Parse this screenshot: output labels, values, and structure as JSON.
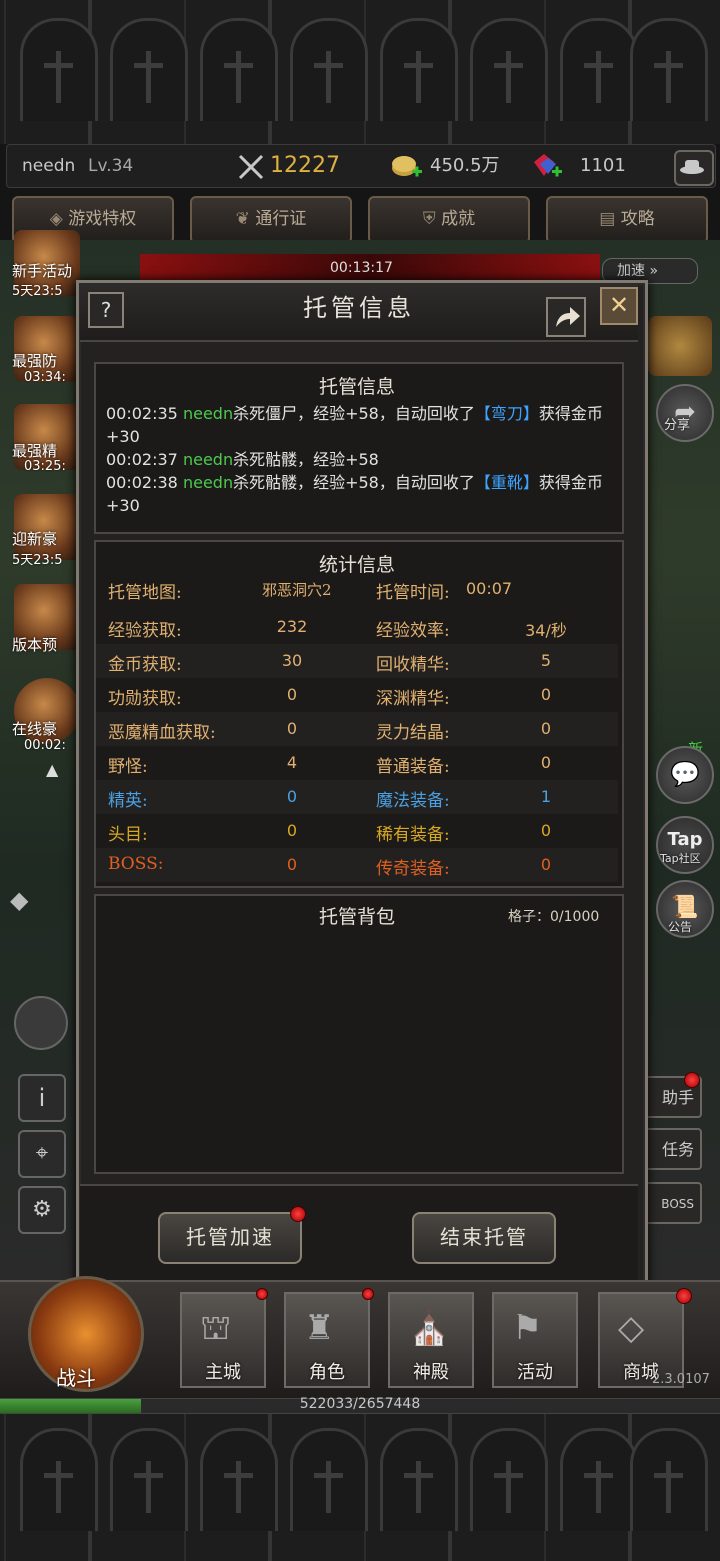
{
  "topbar": {
    "player_name": "needn",
    "level": "Lv.34",
    "combat_power": "12227",
    "gold": "450.5万",
    "gems": "1101"
  },
  "tabs": [
    {
      "label": "游戏特权"
    },
    {
      "label": "通行证"
    },
    {
      "label": "成就"
    },
    {
      "label": "攻略"
    }
  ],
  "event_bar": {
    "timer": "00:13:17",
    "speed_label": "加速"
  },
  "left_sidebar": [
    {
      "label": "新手活动",
      "time": "5天23:5"
    },
    {
      "label": "最强防",
      "time": "03:34:"
    },
    {
      "label": "最强精",
      "time": "03:25:"
    },
    {
      "label": "迎新豪",
      "time": "5天23:5"
    },
    {
      "label": "版本预",
      "time": ""
    },
    {
      "label": "在线豪",
      "time": "00:02:"
    }
  ],
  "right_sidebar": [
    {
      "label": "分享"
    },
    {
      "label": "新"
    },
    {
      "label": "Tap社区"
    },
    {
      "label": "公告"
    }
  ],
  "right_side_tabs": [
    "助手",
    "任务",
    "BOSS"
  ],
  "dialog": {
    "title": "托管信息",
    "help_label": "?",
    "close_label": "✕",
    "log_section": {
      "title": "托管信息",
      "entries": [
        {
          "time": "00:02:35",
          "name": "needn",
          "text": "杀死僵尸，经验+58，自动回收了",
          "item": "【弯刀】",
          "reward": "获得金币+30"
        },
        {
          "time": "00:02:37",
          "name": "needn",
          "text": "杀死骷髅，经验+58",
          "item": "",
          "reward": ""
        },
        {
          "time": "00:02:38",
          "name": "needn",
          "text": "杀死骷髅，经验+58，自动回收了",
          "item": "【重靴】",
          "reward": "获得金币+30"
        }
      ]
    },
    "stats_section": {
      "title": "统计信息",
      "map_label": "托管地图:",
      "map_value": "邪恶洞穴2",
      "time_label": "托管时间:",
      "time_value": "00:07",
      "rows": [
        {
          "l_label": "经验获取:",
          "l_value": "232",
          "r_label": "经验效率:",
          "r_value": "34/秒",
          "color": "#e0b070"
        },
        {
          "l_label": "金币获取:",
          "l_value": "30",
          "r_label": "回收精华:",
          "r_value": "5",
          "color": "#e0b070"
        },
        {
          "l_label": "功勋获取:",
          "l_value": "0",
          "r_label": "深渊精华:",
          "r_value": "0",
          "color": "#e0b070"
        },
        {
          "l_label": "恶魔精血获取:",
          "l_value": "0",
          "r_label": "灵力结晶:",
          "r_value": "0",
          "color": "#e0b070"
        },
        {
          "l_label": "野怪:",
          "l_value": "4",
          "r_label": "普通装备:",
          "r_value": "0",
          "color": "#e0b070"
        },
        {
          "l_label": "精英:",
          "l_value": "0",
          "r_label": "魔法装备:",
          "r_value": "1",
          "color": "#4aa0e0"
        },
        {
          "l_label": "头目:",
          "l_value": "0",
          "r_label": "稀有装备:",
          "r_value": "0",
          "color": "#d8a820"
        },
        {
          "l_label": "BOSS:",
          "l_value": "0",
          "r_label": "传奇装备:",
          "r_value": "0",
          "color": "#e06020"
        }
      ]
    },
    "bag_section": {
      "title": "托管背包",
      "slots": "格子：0/1000"
    },
    "buttons": {
      "speed_up": "托管加速",
      "end": "结束托管"
    }
  },
  "bottom_nav": [
    {
      "label": "战斗"
    },
    {
      "label": "主城"
    },
    {
      "label": "角色"
    },
    {
      "label": "神殿"
    },
    {
      "label": "活动"
    },
    {
      "label": "商城"
    }
  ],
  "version": "2.3.0107",
  "exp_bar": {
    "text": "522033/2657448",
    "progress": 0.196
  }
}
